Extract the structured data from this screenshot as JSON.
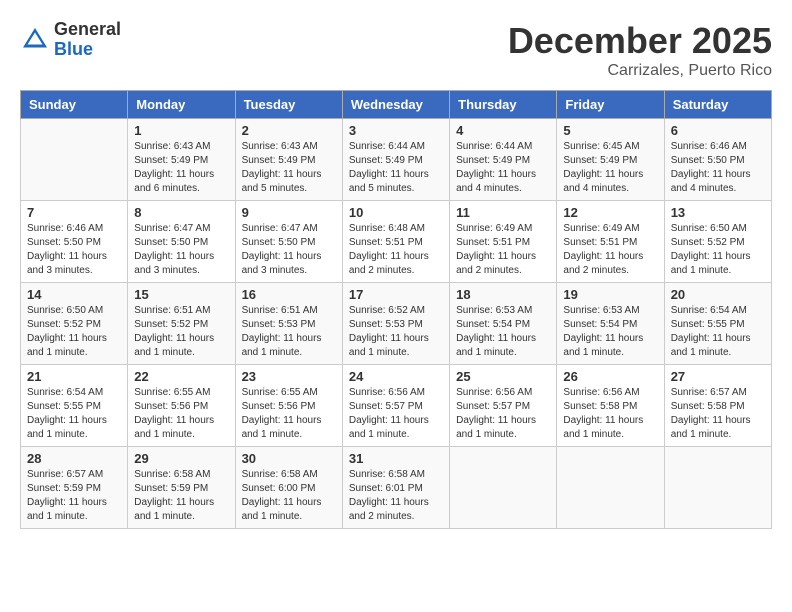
{
  "header": {
    "logo_general": "General",
    "logo_blue": "Blue",
    "month": "December 2025",
    "location": "Carrizales, Puerto Rico"
  },
  "days_of_week": [
    "Sunday",
    "Monday",
    "Tuesday",
    "Wednesday",
    "Thursday",
    "Friday",
    "Saturday"
  ],
  "weeks": [
    [
      {
        "day": "",
        "sunrise": "",
        "sunset": "",
        "daylight": ""
      },
      {
        "day": "1",
        "sunrise": "Sunrise: 6:43 AM",
        "sunset": "Sunset: 5:49 PM",
        "daylight": "Daylight: 11 hours and 6 minutes."
      },
      {
        "day": "2",
        "sunrise": "Sunrise: 6:43 AM",
        "sunset": "Sunset: 5:49 PM",
        "daylight": "Daylight: 11 hours and 5 minutes."
      },
      {
        "day": "3",
        "sunrise": "Sunrise: 6:44 AM",
        "sunset": "Sunset: 5:49 PM",
        "daylight": "Daylight: 11 hours and 5 minutes."
      },
      {
        "day": "4",
        "sunrise": "Sunrise: 6:44 AM",
        "sunset": "Sunset: 5:49 PM",
        "daylight": "Daylight: 11 hours and 4 minutes."
      },
      {
        "day": "5",
        "sunrise": "Sunrise: 6:45 AM",
        "sunset": "Sunset: 5:49 PM",
        "daylight": "Daylight: 11 hours and 4 minutes."
      },
      {
        "day": "6",
        "sunrise": "Sunrise: 6:46 AM",
        "sunset": "Sunset: 5:50 PM",
        "daylight": "Daylight: 11 hours and 4 minutes."
      }
    ],
    [
      {
        "day": "7",
        "sunrise": "Sunrise: 6:46 AM",
        "sunset": "Sunset: 5:50 PM",
        "daylight": "Daylight: 11 hours and 3 minutes."
      },
      {
        "day": "8",
        "sunrise": "Sunrise: 6:47 AM",
        "sunset": "Sunset: 5:50 PM",
        "daylight": "Daylight: 11 hours and 3 minutes."
      },
      {
        "day": "9",
        "sunrise": "Sunrise: 6:47 AM",
        "sunset": "Sunset: 5:50 PM",
        "daylight": "Daylight: 11 hours and 3 minutes."
      },
      {
        "day": "10",
        "sunrise": "Sunrise: 6:48 AM",
        "sunset": "Sunset: 5:51 PM",
        "daylight": "Daylight: 11 hours and 2 minutes."
      },
      {
        "day": "11",
        "sunrise": "Sunrise: 6:49 AM",
        "sunset": "Sunset: 5:51 PM",
        "daylight": "Daylight: 11 hours and 2 minutes."
      },
      {
        "day": "12",
        "sunrise": "Sunrise: 6:49 AM",
        "sunset": "Sunset: 5:51 PM",
        "daylight": "Daylight: 11 hours and 2 minutes."
      },
      {
        "day": "13",
        "sunrise": "Sunrise: 6:50 AM",
        "sunset": "Sunset: 5:52 PM",
        "daylight": "Daylight: 11 hours and 1 minute."
      }
    ],
    [
      {
        "day": "14",
        "sunrise": "Sunrise: 6:50 AM",
        "sunset": "Sunset: 5:52 PM",
        "daylight": "Daylight: 11 hours and 1 minute."
      },
      {
        "day": "15",
        "sunrise": "Sunrise: 6:51 AM",
        "sunset": "Sunset: 5:52 PM",
        "daylight": "Daylight: 11 hours and 1 minute."
      },
      {
        "day": "16",
        "sunrise": "Sunrise: 6:51 AM",
        "sunset": "Sunset: 5:53 PM",
        "daylight": "Daylight: 11 hours and 1 minute."
      },
      {
        "day": "17",
        "sunrise": "Sunrise: 6:52 AM",
        "sunset": "Sunset: 5:53 PM",
        "daylight": "Daylight: 11 hours and 1 minute."
      },
      {
        "day": "18",
        "sunrise": "Sunrise: 6:53 AM",
        "sunset": "Sunset: 5:54 PM",
        "daylight": "Daylight: 11 hours and 1 minute."
      },
      {
        "day": "19",
        "sunrise": "Sunrise: 6:53 AM",
        "sunset": "Sunset: 5:54 PM",
        "daylight": "Daylight: 11 hours and 1 minute."
      },
      {
        "day": "20",
        "sunrise": "Sunrise: 6:54 AM",
        "sunset": "Sunset: 5:55 PM",
        "daylight": "Daylight: 11 hours and 1 minute."
      }
    ],
    [
      {
        "day": "21",
        "sunrise": "Sunrise: 6:54 AM",
        "sunset": "Sunset: 5:55 PM",
        "daylight": "Daylight: 11 hours and 1 minute."
      },
      {
        "day": "22",
        "sunrise": "Sunrise: 6:55 AM",
        "sunset": "Sunset: 5:56 PM",
        "daylight": "Daylight: 11 hours and 1 minute."
      },
      {
        "day": "23",
        "sunrise": "Sunrise: 6:55 AM",
        "sunset": "Sunset: 5:56 PM",
        "daylight": "Daylight: 11 hours and 1 minute."
      },
      {
        "day": "24",
        "sunrise": "Sunrise: 6:56 AM",
        "sunset": "Sunset: 5:57 PM",
        "daylight": "Daylight: 11 hours and 1 minute."
      },
      {
        "day": "25",
        "sunrise": "Sunrise: 6:56 AM",
        "sunset": "Sunset: 5:57 PM",
        "daylight": "Daylight: 11 hours and 1 minute."
      },
      {
        "day": "26",
        "sunrise": "Sunrise: 6:56 AM",
        "sunset": "Sunset: 5:58 PM",
        "daylight": "Daylight: 11 hours and 1 minute."
      },
      {
        "day": "27",
        "sunrise": "Sunrise: 6:57 AM",
        "sunset": "Sunset: 5:58 PM",
        "daylight": "Daylight: 11 hours and 1 minute."
      }
    ],
    [
      {
        "day": "28",
        "sunrise": "Sunrise: 6:57 AM",
        "sunset": "Sunset: 5:59 PM",
        "daylight": "Daylight: 11 hours and 1 minute."
      },
      {
        "day": "29",
        "sunrise": "Sunrise: 6:58 AM",
        "sunset": "Sunset: 5:59 PM",
        "daylight": "Daylight: 11 hours and 1 minute."
      },
      {
        "day": "30",
        "sunrise": "Sunrise: 6:58 AM",
        "sunset": "Sunset: 6:00 PM",
        "daylight": "Daylight: 11 hours and 1 minute."
      },
      {
        "day": "31",
        "sunrise": "Sunrise: 6:58 AM",
        "sunset": "Sunset: 6:01 PM",
        "daylight": "Daylight: 11 hours and 2 minutes."
      },
      {
        "day": "",
        "sunrise": "",
        "sunset": "",
        "daylight": ""
      },
      {
        "day": "",
        "sunrise": "",
        "sunset": "",
        "daylight": ""
      },
      {
        "day": "",
        "sunrise": "",
        "sunset": "",
        "daylight": ""
      }
    ]
  ]
}
